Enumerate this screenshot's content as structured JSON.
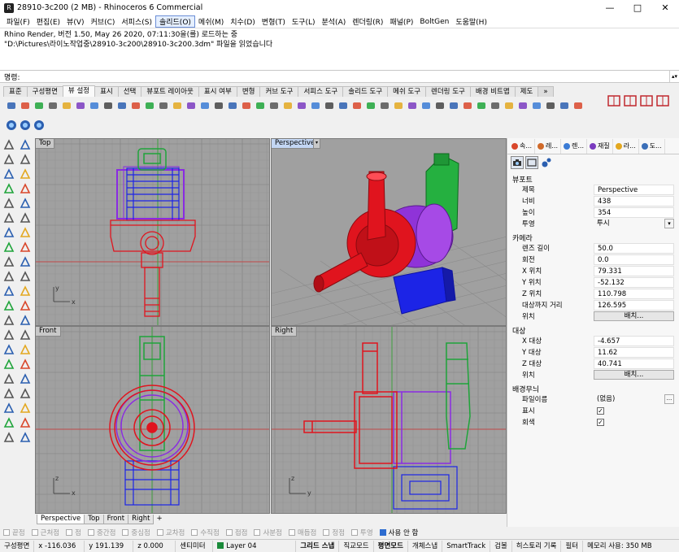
{
  "window": {
    "title": "28910-3c200 (2 MB) - Rhinoceros 6 Commercial",
    "minimize": "—",
    "maximize": "□",
    "close": "✕"
  },
  "menu": [
    "파일(F)",
    "편집(E)",
    "뷰(V)",
    "커브(C)",
    "서피스(S)",
    "솔리드(O)",
    "메쉬(M)",
    "치수(D)",
    "변형(T)",
    "도구(L)",
    "분석(A)",
    "렌더링(R)",
    "패널(P)",
    "BoltGen",
    "도움말(H)"
  ],
  "menu_active_index": 5,
  "history": {
    "line1": "Rhino Render, 버전 1.50, May 26 2020, 07:11:30을(를) 로드하는 중",
    "line2": "\"D:\\Pictures\\라이노작업중\\28910-3c200\\28910-3c200.3dm\" 파일을 읽었습니다"
  },
  "command": {
    "label": "명령:",
    "value": ""
  },
  "toolbar_tabs": [
    "표준",
    "구성평면",
    "뷰 설정",
    "표시",
    "선택",
    "뷰포트 레이아웃",
    "표시 여부",
    "변형",
    "커브 도구",
    "서피스 도구",
    "솔리드 도구",
    "메쉬 도구",
    "렌더링 도구",
    "배경 비트맵",
    "제도",
    "»"
  ],
  "toolbar_active_tab": 2,
  "viewports": {
    "top": "Top",
    "perspective": "Perspective",
    "front": "Front",
    "right": "Right",
    "axis_x": "x",
    "axis_y": "y",
    "axis_z": "z"
  },
  "viewport_tabs": [
    "Perspective",
    "Top",
    "Front",
    "Right",
    "+"
  ],
  "viewport_tab_active": 0,
  "osnaps": [
    {
      "label": "끝점",
      "checked": false
    },
    {
      "label": "근처점",
      "checked": false
    },
    {
      "label": "점",
      "checked": false
    },
    {
      "label": "중간점",
      "checked": false
    },
    {
      "label": "중심점",
      "checked": false
    },
    {
      "label": "교차점",
      "checked": false
    },
    {
      "label": "수직점",
      "checked": false
    },
    {
      "label": "접점",
      "checked": false
    },
    {
      "label": "사분점",
      "checked": false
    },
    {
      "label": "매듭점",
      "checked": false
    },
    {
      "label": "정점",
      "checked": false
    },
    {
      "label": "투영",
      "checked": false
    },
    {
      "label": "사용 안 함",
      "checked": true
    }
  ],
  "status": {
    "cplane": "구성평면",
    "x": "x -116.036",
    "y": "y 191.139",
    "z": "z 0.000",
    "units": "센티미터",
    "layer": "Layer 04",
    "grid_snap": "그리드 스냅",
    "ortho": "직교모드",
    "planar": "평면모드",
    "osnap": "개체스냅",
    "smarttrack": "SmartTrack",
    "gumball": "검볼",
    "history": "히스토리 기록",
    "filter": "필터",
    "memory": "메모리 사용: 350 MB"
  },
  "panel": {
    "tabs": [
      {
        "label": "속...",
        "color": "#d9472b"
      },
      {
        "label": "레...",
        "color": "#d06a2a"
      },
      {
        "label": "렌...",
        "color": "#3a7bd5"
      },
      {
        "label": "재질",
        "color": "#7a3bbf"
      },
      {
        "label": "라...",
        "color": "#e3a820"
      },
      {
        "label": "도...",
        "color": "#3b6fb8"
      }
    ],
    "viewport_section": "뷰포트",
    "title_label": "제목",
    "title_value": "Perspective",
    "width_label": "너비",
    "width_value": "438",
    "height_label": "높이",
    "height_value": "354",
    "projection_label": "투영",
    "projection_value": "투시",
    "camera_section": "카메라",
    "lens_label": "렌즈 길이",
    "lens_value": "50.0",
    "rotation_label": "회전",
    "rotation_value": "0.0",
    "xpos_label": "X 위치",
    "xpos_value": "79.331",
    "ypos_label": "Y 위치",
    "ypos_value": "-52.132",
    "zpos_label": "Z 위치",
    "zpos_value": "110.798",
    "dist_label": "대상까지 거리",
    "dist_value": "126.595",
    "cam_place_label": "위치",
    "place_button": "배치...",
    "target_section": "대상",
    "xt_label": "X 대상",
    "xt_value": "-4.657",
    "yt_label": "Y 대상",
    "yt_value": "11.62",
    "zt_label": "Z 대상",
    "zt_value": "40.741",
    "tgt_place_label": "위치",
    "wallpaper_section": "배경무늬",
    "filename_label": "파일이름",
    "filename_value": "(없음)",
    "show_label": "표시",
    "gray_label": "회색",
    "check": "✓"
  },
  "colors": {
    "red": "#e0141e",
    "blue": "#1c24e6",
    "green": "#1fa43a",
    "purple": "#8a2be2",
    "viewport_bg": "#a0a0a0"
  }
}
